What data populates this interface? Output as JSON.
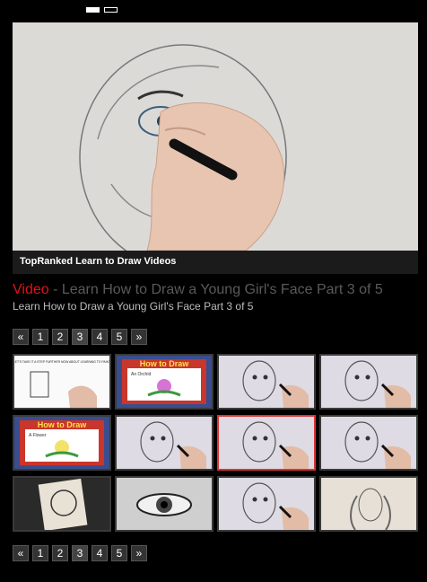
{
  "carousel": {
    "dots": 2,
    "active_index": 0
  },
  "video": {
    "caption": "TopRanked Learn to Draw Videos"
  },
  "heading": {
    "label": "Video",
    "separator": " - ",
    "title": "Learn How to Draw a Young Girl's Face Part 3 of 5",
    "subtitle": "Learn How to Draw a Young Girl's Face Part 3 of 5"
  },
  "pagination": {
    "prev": "«",
    "next": "»",
    "pages": [
      "1",
      "2",
      "3",
      "4",
      "5"
    ],
    "current": "3"
  },
  "thumbnails": [
    {
      "kind": "whiteboard",
      "text": "LET'S TAKE IT A STEP FURTHER NOW ABOUT LEARNING TO PAINT"
    },
    {
      "kind": "board",
      "text": "How to Draw",
      "sub": "An Orchid"
    },
    {
      "kind": "sketch"
    },
    {
      "kind": "sketch"
    },
    {
      "kind": "board",
      "text": "How to Draw",
      "sub": "A Flower"
    },
    {
      "kind": "sketch"
    },
    {
      "kind": "sketch",
      "selected": true
    },
    {
      "kind": "sketch"
    },
    {
      "kind": "photo"
    },
    {
      "kind": "eye"
    },
    {
      "kind": "sketch"
    },
    {
      "kind": "portrait"
    }
  ],
  "colors": {
    "accent": "#e0121e",
    "background": "#000000",
    "muted_text": "#5a5a5a"
  }
}
